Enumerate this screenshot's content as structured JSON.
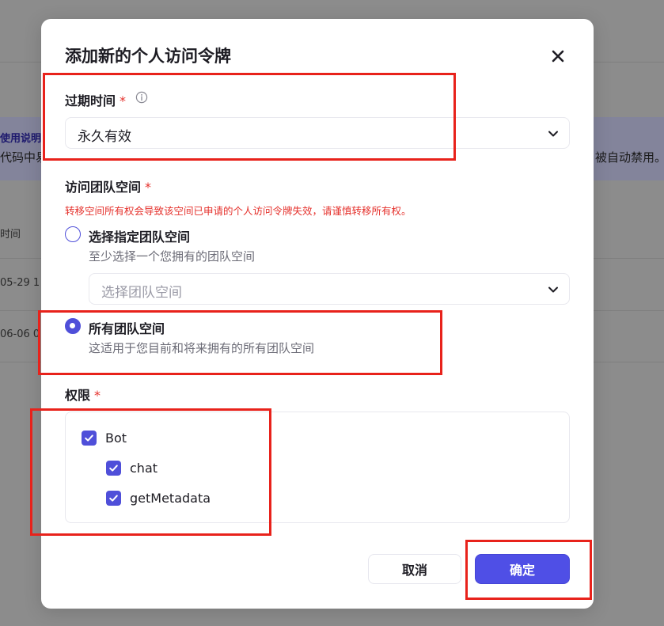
{
  "background": {
    "usage_link": "使用说明",
    "banner_left": "代码中易",
    "banner_right": "被自动禁用。",
    "column_header": "时间",
    "row1_time": "05-29 1",
    "row2_time": "06-06 0"
  },
  "modal": {
    "title": "添加新的个人访问令牌",
    "close_icon": "close-icon",
    "expiration": {
      "label": "过期时间",
      "required_mark": "*",
      "info_icon": "info-icon",
      "selected_value": "永久有效",
      "chevron_icon": "chevron-down-icon"
    },
    "workspace": {
      "label": "访问团队空间",
      "required_mark": "*",
      "warning": "转移空间所有权会导致该空间已申请的个人访问令牌失效，请谨慎转移所有权。",
      "option_specific": {
        "label": "选择指定团队空间",
        "description": "至少选择一个您拥有的团队空间",
        "checked": false
      },
      "select_placeholder": "选择团队空间",
      "option_all": {
        "label": "所有团队空间",
        "description": "这适用于您目前和将来拥有的所有团队空间",
        "checked": true
      }
    },
    "permissions": {
      "label": "权限",
      "required_mark": "*",
      "items": [
        {
          "label": "Bot",
          "checked": true
        },
        {
          "label": "chat",
          "checked": true
        },
        {
          "label": "getMetadata",
          "checked": true
        }
      ]
    },
    "buttons": {
      "cancel": "取消",
      "confirm": "确定"
    }
  },
  "colors": {
    "accent": "#4f4fe6",
    "required": "#e5312c",
    "annotation": "#e8221b",
    "overlay": "#8c8c8c"
  }
}
